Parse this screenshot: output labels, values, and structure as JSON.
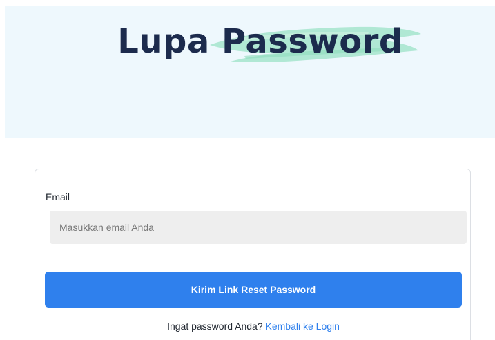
{
  "hero": {
    "title": "Lupa Password",
    "brush_color": "#a8e6cf"
  },
  "form": {
    "email_label": "Email",
    "email_placeholder": "Masukkan email Anda",
    "email_value": "",
    "submit_label": "Kirim Link Reset Password",
    "footer_prompt": "Ingat password Anda?",
    "login_link_label": "Kembali ke Login"
  },
  "colors": {
    "hero_bg": "#eef8fd",
    "title": "#1c2b4d",
    "primary": "#2f80ed",
    "input_bg": "#eeeeee"
  }
}
